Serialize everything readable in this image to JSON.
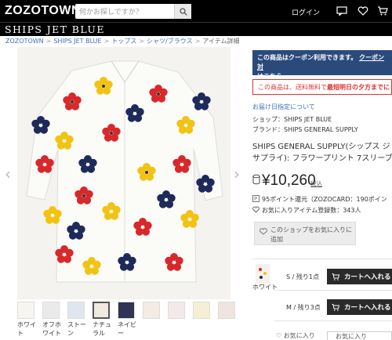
{
  "header": {
    "logo": "ZOZOTOWN",
    "search_placeholder": "何かお探しですか？",
    "login": "ログイン"
  },
  "shop": {
    "name": "SHIPS JET BLUE"
  },
  "breadcrumb": [
    "ZOZOTOWN",
    "SHIPS JET BLUE",
    "トップス",
    "シャツ/ブラウス",
    "アイテム詳細"
  ],
  "product": {
    "coupon_text": "この商品はクーポン利用できます。",
    "coupon_link": "クーポン対",
    "coupon_link2": "はこちら",
    "shipping_notice_pre": "この商品は、送料無料で",
    "shipping_notice_bold": "最短明日の夕方までに",
    "delivery_link": "お届け日指定について",
    "shop_line": "ショップ：SHIPS JET BLUE",
    "brand_line": "ブランド：SHIPS GENERAL SUPPLY",
    "title_line1": "SHIPS GENERAL SUPPLY(シップス ジ",
    "title_line2": "サプライ): フラワープリント 7スリーブ",
    "price": "¥10,260",
    "tax_label": "税込",
    "points": "95ポイント還元（ZOZOCARD：190ポイン",
    "favorites": "お気に入りアイテム登録数：343人",
    "fav_shop_line1": "このショップをお気に入りに",
    "fav_shop_line2": "追加"
  },
  "thumbnails": [
    {
      "label": "ホワイト"
    },
    {
      "label": "オフホワイト"
    },
    {
      "label": "ストーン"
    },
    {
      "label": "ナチュラル"
    },
    {
      "label": "ネイビー"
    },
    {
      "label": ""
    },
    {
      "label": ""
    },
    {
      "label": ""
    },
    {
      "label": ""
    }
  ],
  "variants": {
    "color": "ホワイト",
    "sizes": [
      {
        "size": "S",
        "stock": "S / 残り1点",
        "cart": "カートへ入れる"
      },
      {
        "size": "M",
        "stock": "M / 残り3点",
        "cart": "カートへ入れる"
      }
    ],
    "fav_left": "♡ お気に入り",
    "fav_right": "お気に入り"
  },
  "colors": {
    "header_bg": "#000000",
    "coupon_bg": "#2b4a7c",
    "notice_red": "#dd3333",
    "link_blue": "#3d6fb8"
  }
}
